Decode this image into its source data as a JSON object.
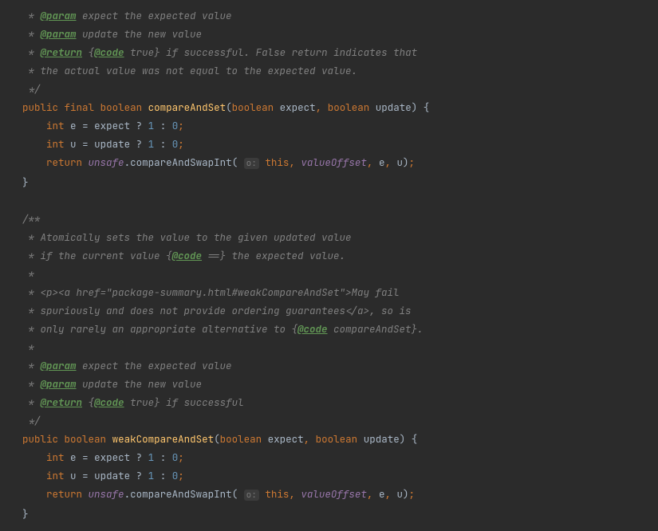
{
  "indent": "    ",
  "doc1": {
    "param1_tag": "@param",
    "param1_text": " expect the expected value",
    "param2_tag": "@param",
    "param2_text": " update the new value",
    "return_tag": "@return",
    "return_lbrace": " {",
    "return_code_tag": "@code",
    "return_code_rest": " true} if successful. False return indicates that",
    "line2": " * the actual value was not equal to the expected value.",
    "close": " */"
  },
  "method1": {
    "mod_public": "public",
    "mod_final": "final",
    "type_bool": "boolean",
    "name": "compareAndSet",
    "p1_type": "boolean",
    "p1_name": "expect",
    "p2_type": "boolean",
    "p2_name": "update",
    "kw_int": "int",
    "var_e": "e",
    "var_u": "u",
    "expr_expect": "expect",
    "expr_update": "update",
    "one": "1",
    "zero": "0",
    "kw_return": "return",
    "unsafe": "unsafe",
    "call": "compareAndSwapInt",
    "hint": "o:",
    "this": "this",
    "valueOffset": "valueOffset",
    "arg_e": "e",
    "arg_u": "u"
  },
  "doc2": {
    "open": "/**",
    "l1": " * Atomically sets the value to the given updated value",
    "l2a": " * if the current value {",
    "l2_tag": "@code",
    "l2b": " ==} the expected value.",
    "blank": " *",
    "l3a": " * <p><a href=\"package-summary.html#weakCompareAndSet\">",
    "l3b": "May fail",
    "l4a": " * spuriously and does not provide ordering guarantees</a>",
    "l4b": ", so is",
    "l5a": " * only rarely an appropriate alternative to {",
    "l5_tag": "@code",
    "l5b": " compareAndSet}.",
    "param1_tag": "@param",
    "param1_text": " expect the expected value",
    "param2_tag": "@param",
    "param2_text": " update the new value",
    "return_tag": "@return",
    "return_lbrace": " {",
    "return_code_tag": "@code",
    "return_code_rest": " true} if successful",
    "close": " */"
  },
  "method2": {
    "mod_public": "public",
    "type_bool": "boolean",
    "name": "weakCompareAndSet",
    "p1_type": "boolean",
    "p1_name": "expect",
    "p2_type": "boolean",
    "p2_name": "update",
    "kw_int": "int",
    "var_e": "e",
    "var_u": "u",
    "expr_expect": "expect",
    "expr_update": "update",
    "one": "1",
    "zero": "0",
    "kw_return": "return",
    "unsafe": "unsafe",
    "call": "compareAndSwapInt",
    "hint": "o:",
    "this": "this",
    "valueOffset": "valueOffset",
    "arg_e": "e",
    "arg_u": "u"
  }
}
